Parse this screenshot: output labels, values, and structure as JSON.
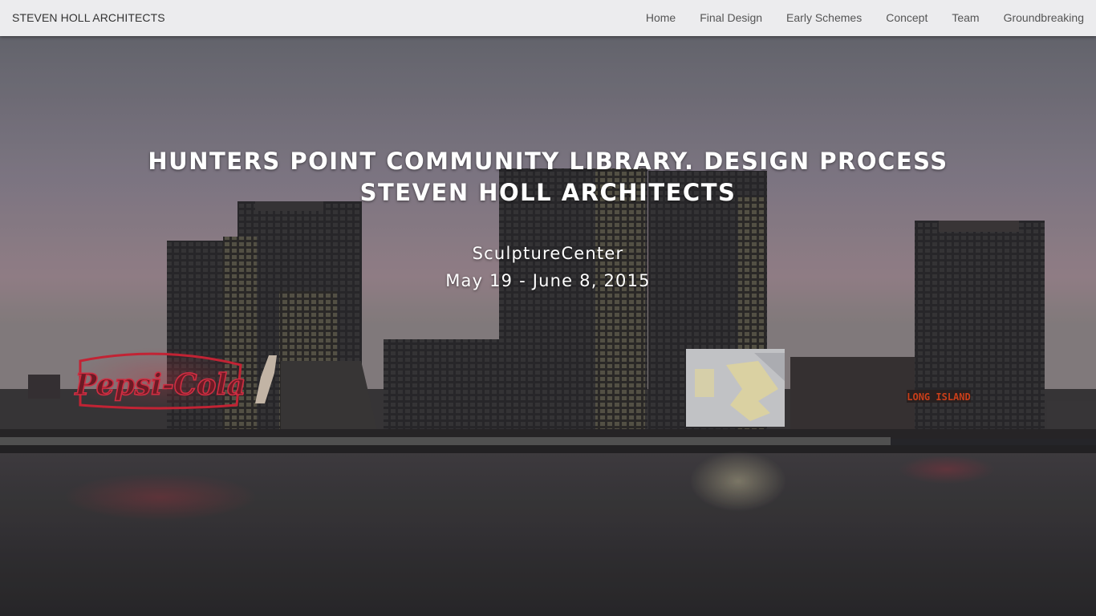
{
  "navbar": {
    "brand": "STEVEN HOLL ARCHITECTS",
    "links": [
      "Home",
      "Final Design",
      "Early Schemes",
      "Concept",
      "Team",
      "Groundbreaking"
    ]
  },
  "hero": {
    "title_line1": "HUNTERS POINT COMMUNITY LIBRARY. DESIGN PROCESS",
    "title_line2": "STEVEN HOLL ARCHITECTS",
    "venue": "SculptureCenter",
    "dates": "May 19 - June 8, 2015",
    "sign_pepsi": "Pepsi-Cola",
    "sign_long_island": "LONG ISLAND"
  },
  "colors": {
    "navbar_bg": "#ececee",
    "sky_top": "#6f7079",
    "sky_horizon": "#a38c94",
    "water": "#3a393c",
    "neon_red": "#d8283a",
    "neon_orange": "#e0461c"
  }
}
